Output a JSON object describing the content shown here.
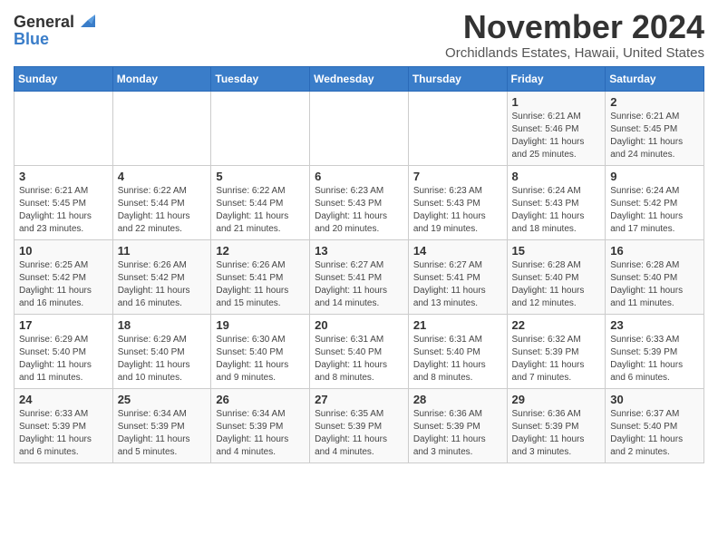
{
  "header": {
    "logo_general": "General",
    "logo_blue": "Blue",
    "month_title": "November 2024",
    "location": "Orchidlands Estates, Hawaii, United States"
  },
  "days_of_week": [
    "Sunday",
    "Monday",
    "Tuesday",
    "Wednesday",
    "Thursday",
    "Friday",
    "Saturday"
  ],
  "weeks": [
    [
      {
        "day": "",
        "info": ""
      },
      {
        "day": "",
        "info": ""
      },
      {
        "day": "",
        "info": ""
      },
      {
        "day": "",
        "info": ""
      },
      {
        "day": "",
        "info": ""
      },
      {
        "day": "1",
        "info": "Sunrise: 6:21 AM\nSunset: 5:46 PM\nDaylight: 11 hours and 25 minutes."
      },
      {
        "day": "2",
        "info": "Sunrise: 6:21 AM\nSunset: 5:45 PM\nDaylight: 11 hours and 24 minutes."
      }
    ],
    [
      {
        "day": "3",
        "info": "Sunrise: 6:21 AM\nSunset: 5:45 PM\nDaylight: 11 hours and 23 minutes."
      },
      {
        "day": "4",
        "info": "Sunrise: 6:22 AM\nSunset: 5:44 PM\nDaylight: 11 hours and 22 minutes."
      },
      {
        "day": "5",
        "info": "Sunrise: 6:22 AM\nSunset: 5:44 PM\nDaylight: 11 hours and 21 minutes."
      },
      {
        "day": "6",
        "info": "Sunrise: 6:23 AM\nSunset: 5:43 PM\nDaylight: 11 hours and 20 minutes."
      },
      {
        "day": "7",
        "info": "Sunrise: 6:23 AM\nSunset: 5:43 PM\nDaylight: 11 hours and 19 minutes."
      },
      {
        "day": "8",
        "info": "Sunrise: 6:24 AM\nSunset: 5:43 PM\nDaylight: 11 hours and 18 minutes."
      },
      {
        "day": "9",
        "info": "Sunrise: 6:24 AM\nSunset: 5:42 PM\nDaylight: 11 hours and 17 minutes."
      }
    ],
    [
      {
        "day": "10",
        "info": "Sunrise: 6:25 AM\nSunset: 5:42 PM\nDaylight: 11 hours and 16 minutes."
      },
      {
        "day": "11",
        "info": "Sunrise: 6:26 AM\nSunset: 5:42 PM\nDaylight: 11 hours and 16 minutes."
      },
      {
        "day": "12",
        "info": "Sunrise: 6:26 AM\nSunset: 5:41 PM\nDaylight: 11 hours and 15 minutes."
      },
      {
        "day": "13",
        "info": "Sunrise: 6:27 AM\nSunset: 5:41 PM\nDaylight: 11 hours and 14 minutes."
      },
      {
        "day": "14",
        "info": "Sunrise: 6:27 AM\nSunset: 5:41 PM\nDaylight: 11 hours and 13 minutes."
      },
      {
        "day": "15",
        "info": "Sunrise: 6:28 AM\nSunset: 5:40 PM\nDaylight: 11 hours and 12 minutes."
      },
      {
        "day": "16",
        "info": "Sunrise: 6:28 AM\nSunset: 5:40 PM\nDaylight: 11 hours and 11 minutes."
      }
    ],
    [
      {
        "day": "17",
        "info": "Sunrise: 6:29 AM\nSunset: 5:40 PM\nDaylight: 11 hours and 11 minutes."
      },
      {
        "day": "18",
        "info": "Sunrise: 6:29 AM\nSunset: 5:40 PM\nDaylight: 11 hours and 10 minutes."
      },
      {
        "day": "19",
        "info": "Sunrise: 6:30 AM\nSunset: 5:40 PM\nDaylight: 11 hours and 9 minutes."
      },
      {
        "day": "20",
        "info": "Sunrise: 6:31 AM\nSunset: 5:40 PM\nDaylight: 11 hours and 8 minutes."
      },
      {
        "day": "21",
        "info": "Sunrise: 6:31 AM\nSunset: 5:40 PM\nDaylight: 11 hours and 8 minutes."
      },
      {
        "day": "22",
        "info": "Sunrise: 6:32 AM\nSunset: 5:39 PM\nDaylight: 11 hours and 7 minutes."
      },
      {
        "day": "23",
        "info": "Sunrise: 6:33 AM\nSunset: 5:39 PM\nDaylight: 11 hours and 6 minutes."
      }
    ],
    [
      {
        "day": "24",
        "info": "Sunrise: 6:33 AM\nSunset: 5:39 PM\nDaylight: 11 hours and 6 minutes."
      },
      {
        "day": "25",
        "info": "Sunrise: 6:34 AM\nSunset: 5:39 PM\nDaylight: 11 hours and 5 minutes."
      },
      {
        "day": "26",
        "info": "Sunrise: 6:34 AM\nSunset: 5:39 PM\nDaylight: 11 hours and 4 minutes."
      },
      {
        "day": "27",
        "info": "Sunrise: 6:35 AM\nSunset: 5:39 PM\nDaylight: 11 hours and 4 minutes."
      },
      {
        "day": "28",
        "info": "Sunrise: 6:36 AM\nSunset: 5:39 PM\nDaylight: 11 hours and 3 minutes."
      },
      {
        "day": "29",
        "info": "Sunrise: 6:36 AM\nSunset: 5:39 PM\nDaylight: 11 hours and 3 minutes."
      },
      {
        "day": "30",
        "info": "Sunrise: 6:37 AM\nSunset: 5:40 PM\nDaylight: 11 hours and 2 minutes."
      }
    ]
  ]
}
